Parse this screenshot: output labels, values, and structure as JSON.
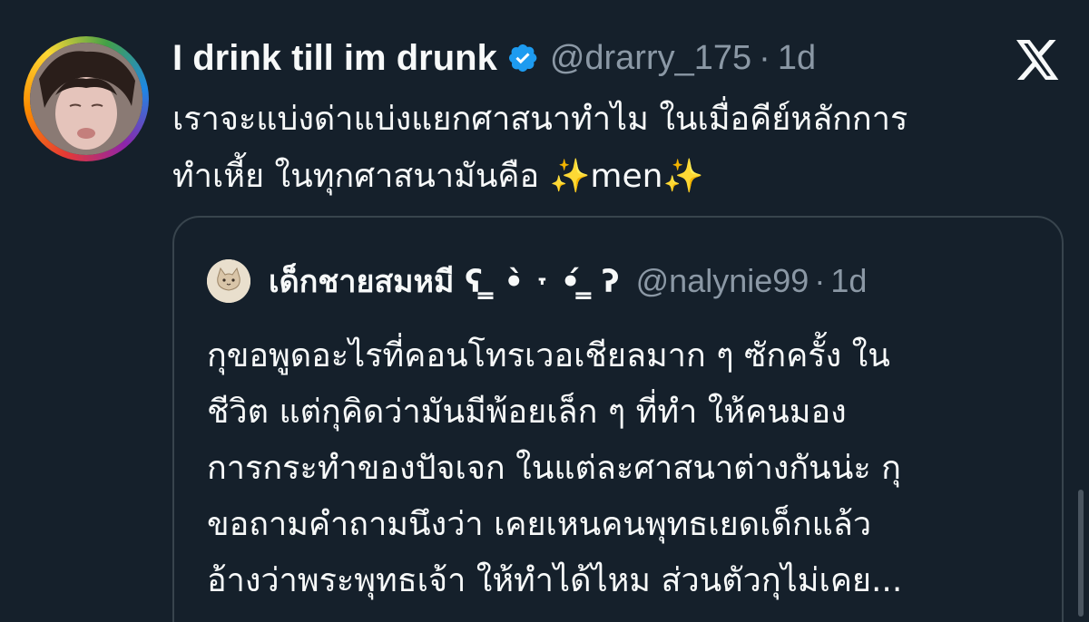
{
  "post": {
    "display_name": "I drink till im drunk",
    "handle": "@drarry_175",
    "separator": "·",
    "time": "1d",
    "body_lines": [
      "เราจะแบ่งด่าแบ่งแยกศาสนาทำไม ในเมื่อคีย์หลักการ",
      "ทำเหี้ย ในทุกศาสนามันคือ ✨men✨"
    ],
    "verified_icon": "verified-badge-icon",
    "avatar_icon": "profile-avatar",
    "app_icon": "x-logo-icon"
  },
  "quote": {
    "display_name": "เด็กชายสมหมี ʕ ̳ •̀ ˕ •́ ̳ ʔ",
    "handle": "@nalynie99",
    "separator": "·",
    "time": "1d",
    "body_lines": [
      "กุขอพูดอะไรที่คอนโทรเวอเชียลมาก ๆ ซักครั้ง ใน",
      "ชีวิต แต่กุคิดว่ามันมีพ้อยเล็ก ๆ ที่ทำ ให้คนมอง",
      "การกระทำของปัจเจก ในแต่ละศาสนาต่างกันน่ะ กุ",
      "ขอถามคำถามนึงว่า เคยเหนคนพุทธเยดเด็กแล้ว",
      "อ้างว่าพระพุทธเจ้า ให้ทำได้ไหม ส่วนตัวกุไม่เคย..."
    ],
    "avatar_icon": "cat-avatar"
  },
  "colors": {
    "background": "#15202b",
    "text_primary": "#f7f9f9",
    "text_secondary": "#8b98a5",
    "border": "#38444d",
    "verified": "#1d9bf0"
  }
}
